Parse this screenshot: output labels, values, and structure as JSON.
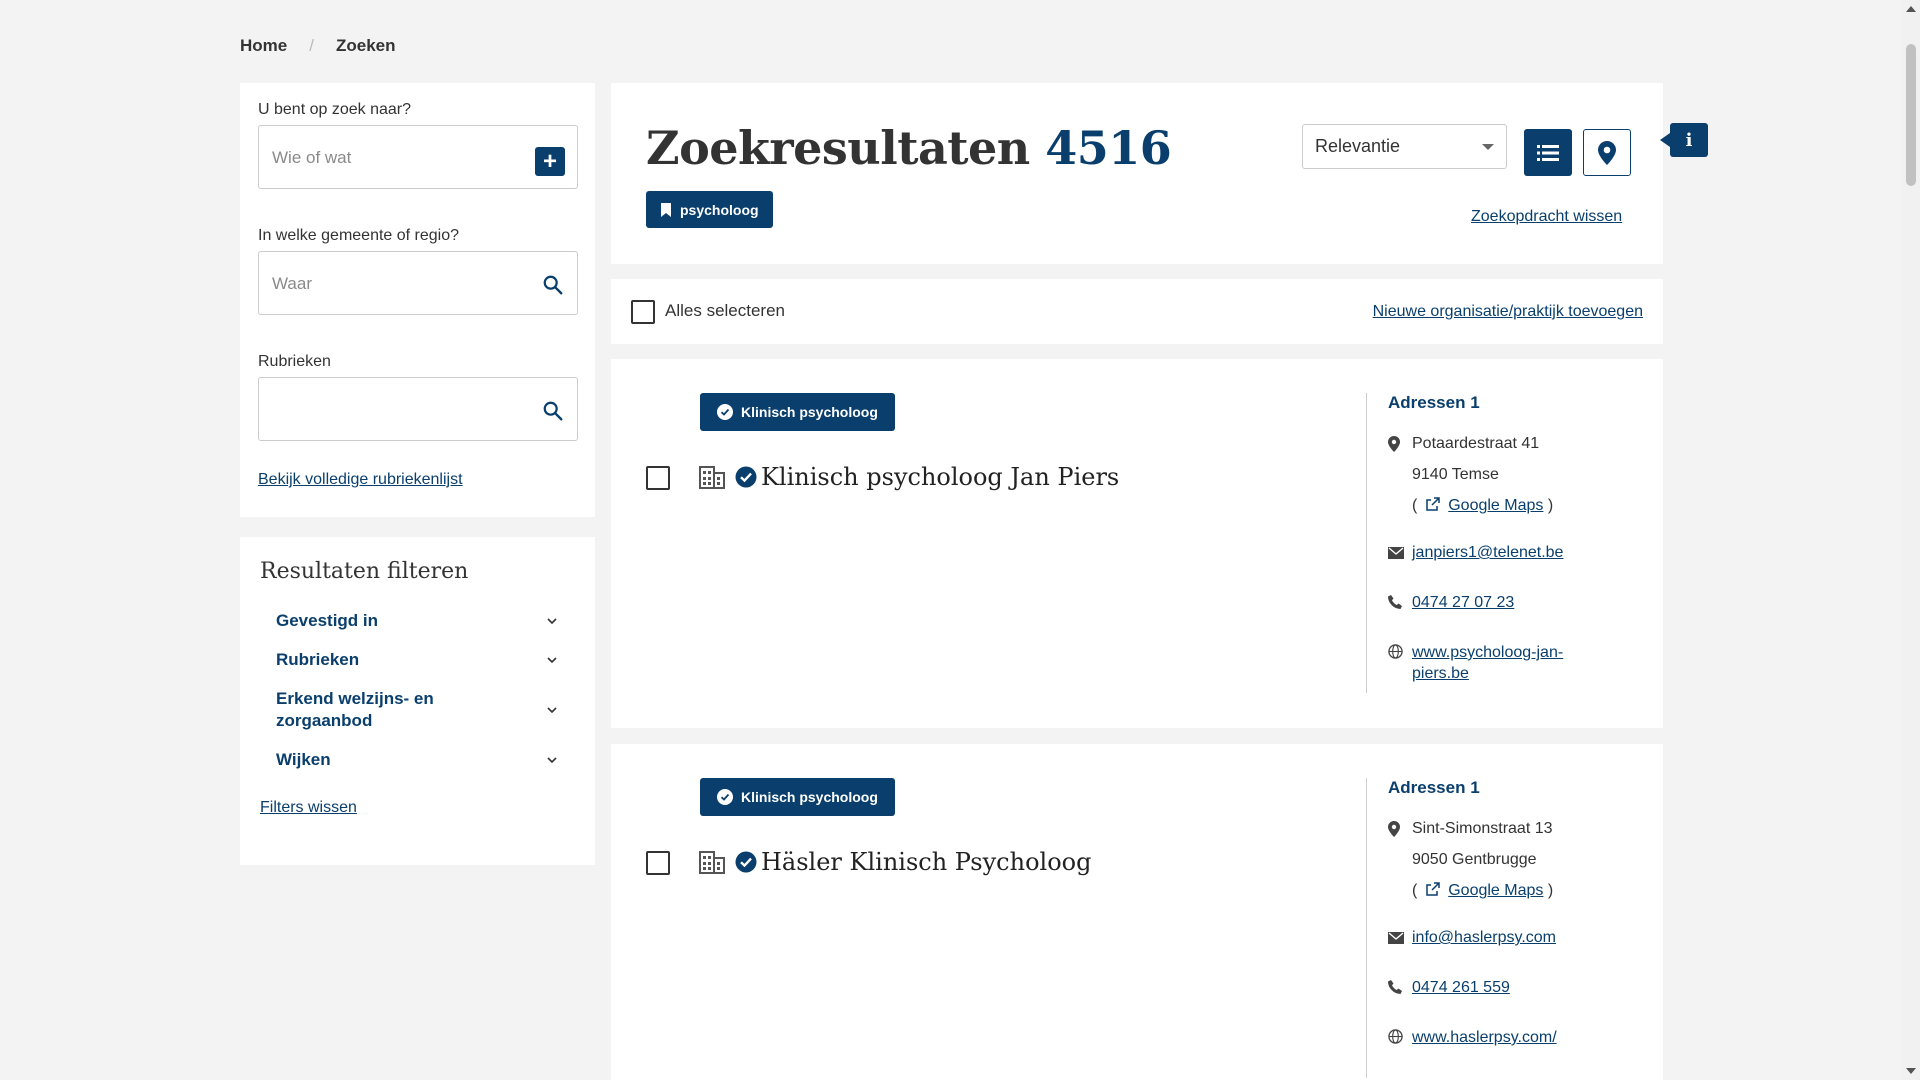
{
  "breadcrumb": {
    "home": "Home",
    "current": "Zoeken",
    "separator": "/"
  },
  "search": {
    "what_label": "U bent op zoek naar?",
    "what_placeholder": "Wie of wat",
    "where_label": "In welke gemeente of regio?",
    "where_placeholder": "Waar",
    "category_label": "Rubrieken",
    "category_placeholder": "",
    "full_list_link": "Bekijk volledige rubriekenlijst"
  },
  "filters": {
    "title": "Resultaten filteren",
    "items": [
      {
        "label": "Gevestigd in"
      },
      {
        "label": "Rubrieken"
      },
      {
        "label": "Erkend welzijns- en zorgaanbod"
      },
      {
        "label": "Wijken"
      }
    ],
    "clear_link": "Filters wissen"
  },
  "results_header": {
    "title": "Zoekresultaten",
    "count": "4516",
    "active_tag": "psycholoog",
    "sort_value": "Relevantie",
    "clear_search": "Zoekopdracht wissen",
    "info_label": "i"
  },
  "select_bar": {
    "select_all": "Alles selecteren",
    "add_org": "Nieuwe organisatie/praktijk toevoegen"
  },
  "results": [
    {
      "badge": "Klinisch psycholoog",
      "name": "Klinisch psycholoog Jan Piers",
      "addresses_title": "Adressen 1",
      "street": "Potaardestraat 41",
      "city": "9140 Temse",
      "maps_open": "(",
      "maps_link": "Google Maps",
      "maps_close": ")",
      "email": "janpiers1@telenet.be",
      "phone": "0474 27 07 23",
      "website": "www.psycholoog-jan-piers.be"
    },
    {
      "badge": "Klinisch psycholoog",
      "name": "Häsler Klinisch Psycholoog",
      "addresses_title": "Adressen 1",
      "street": "Sint-Simonstraat 13",
      "city": "9050 Gentbrugge",
      "maps_open": "(",
      "maps_link": "Google Maps",
      "maps_close": ")",
      "email": "info@haslerpsy.com",
      "phone": "0474 261 559",
      "website": "www.haslerpsy.com/"
    }
  ],
  "colors": {
    "primary": "#0a3f6d",
    "background": "#f3f3f3"
  },
  "icons": [
    "plus-icon",
    "search-icon",
    "chevron-down-icon",
    "bookmark-icon",
    "list-icon",
    "map-pin-icon",
    "info-icon",
    "verified-icon",
    "building-icon",
    "location-icon",
    "external-link-icon",
    "mail-icon",
    "phone-icon",
    "globe-icon"
  ]
}
